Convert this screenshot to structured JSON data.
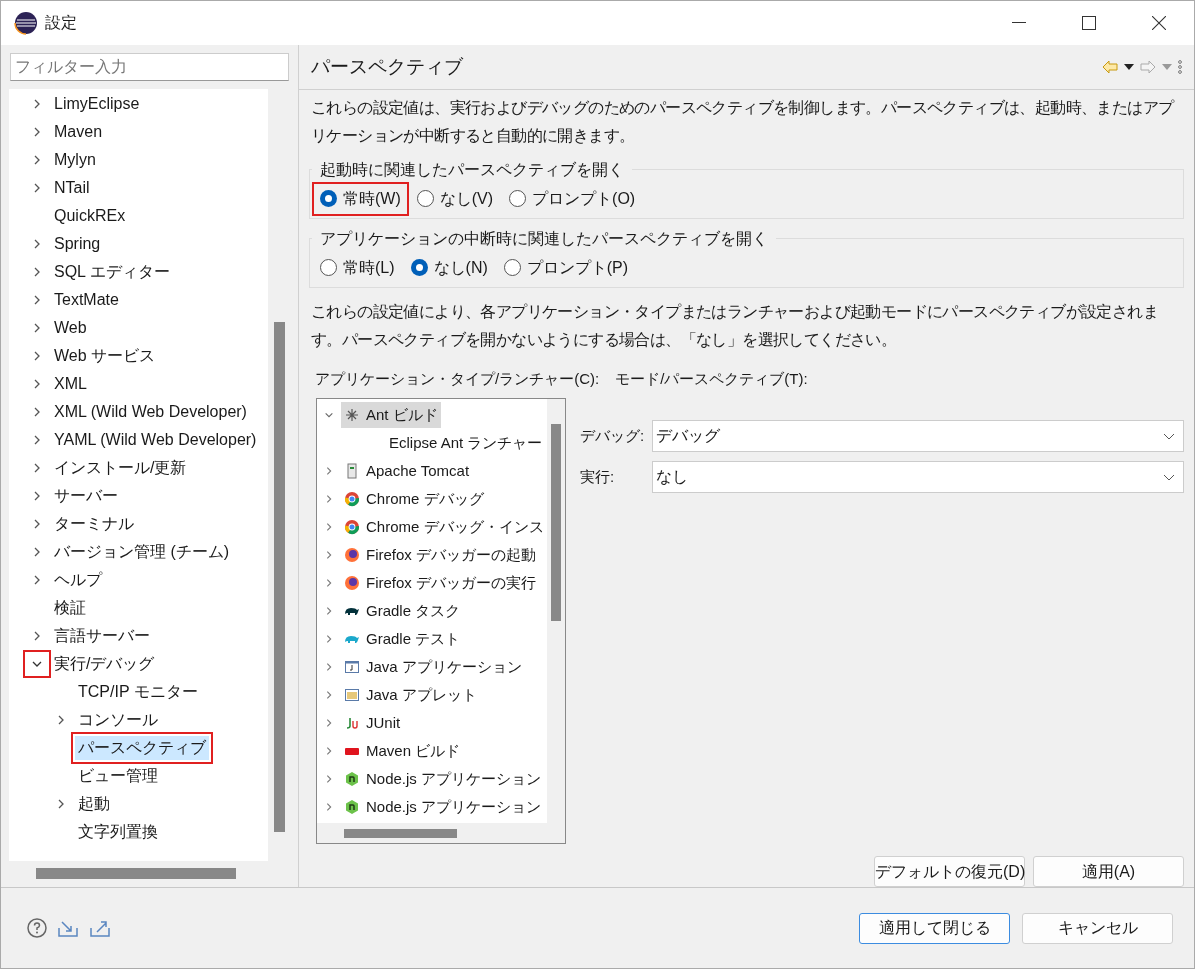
{
  "window": {
    "title": "設定"
  },
  "filter": {
    "placeholder": "フィルター入力"
  },
  "tree": {
    "items": [
      {
        "label": "LimyEclipse",
        "expanded": false,
        "selected": false
      },
      {
        "label": "Maven",
        "expanded": false,
        "selected": false
      },
      {
        "label": "Mylyn",
        "expanded": false,
        "selected": false
      },
      {
        "label": "NTail",
        "expanded": false,
        "selected": false
      },
      {
        "label": "QuickREx",
        "selected": false
      },
      {
        "label": "Spring",
        "expanded": false,
        "selected": false
      },
      {
        "label": "SQL エディター",
        "expanded": false,
        "selected": false
      },
      {
        "label": "TextMate",
        "expanded": false,
        "selected": false
      },
      {
        "label": "Web",
        "expanded": false,
        "selected": false
      },
      {
        "label": "Web サービス",
        "expanded": false,
        "selected": false
      },
      {
        "label": "XML",
        "expanded": false,
        "selected": false
      },
      {
        "label": "XML (Wild Web Developer)",
        "expanded": false,
        "selected": false
      },
      {
        "label": "YAML (Wild Web Developer)",
        "expanded": false,
        "selected": false
      },
      {
        "label": "インストール/更新",
        "expanded": false,
        "selected": false
      },
      {
        "label": "サーバー",
        "expanded": false,
        "selected": false
      },
      {
        "label": "ターミナル",
        "expanded": false,
        "selected": false
      },
      {
        "label": "バージョン管理 (チーム)",
        "expanded": false,
        "selected": false
      },
      {
        "label": "ヘルプ",
        "expanded": false,
        "selected": false
      },
      {
        "label": "検証",
        "selected": false
      },
      {
        "label": "言語サーバー",
        "expanded": false,
        "selected": false
      },
      {
        "label": "実行/デバッグ",
        "expanded": true,
        "selected": false,
        "caret_annotated": true,
        "children": [
          {
            "label": "TCP/IP モニター",
            "selected": false
          },
          {
            "label": "コンソール",
            "expanded": false,
            "selected": false
          },
          {
            "label": "パースペクティブ",
            "selected": true,
            "annotated": true
          },
          {
            "label": "ビュー管理",
            "selected": false
          },
          {
            "label": "起動",
            "expanded": false,
            "selected": false
          },
          {
            "label": "文字列置換",
            "selected": false
          }
        ]
      }
    ]
  },
  "page": {
    "title": "パースペクティブ",
    "description": "これらの設定値は、実行およびデバッグのためのパースペクティブを制御します。パースペクティブは、起動時、またはアプリケーションが中断すると自動的に開きます。",
    "groups": [
      {
        "legend": "起動時に関連したパースペクティブを開く",
        "options": [
          {
            "label": "常時(W)",
            "selected": true,
            "annotated": true
          },
          {
            "label": "なし(V)",
            "selected": false,
            "annotated": false
          },
          {
            "label": "プロンプト(O)",
            "selected": false,
            "annotated": false
          }
        ]
      },
      {
        "legend": "アプリケーションの中断時に関連したパースペクティブを開く",
        "options": [
          {
            "label": "常時(L)",
            "selected": false,
            "annotated": false
          },
          {
            "label": "なし(N)",
            "selected": true,
            "annotated": false
          },
          {
            "label": "プロンプト(P)",
            "selected": false,
            "annotated": false
          }
        ]
      }
    ],
    "description2": "これらの設定値により、各アプリケーション・タイプまたはランチャーおよび起動モードにパースペクティブが設定されます。パースペクティブを開かないようにする場合は、「なし」を選択してください。",
    "launchers_label": "アプリケーション・タイプ/ランチャー(C):",
    "modes_label": "モード/パースペクティブ(T):",
    "launchers": [
      {
        "label": "Ant ビルド",
        "kind": "ant",
        "expanded": true,
        "selected": true,
        "children": [
          {
            "label": "Eclipse Ant ランチャー",
            "selected": false
          }
        ]
      },
      {
        "label": "Apache Tomcat",
        "kind": "server",
        "expanded": false,
        "selected": false
      },
      {
        "label": "Chrome デバッグ",
        "kind": "chrome",
        "expanded": false,
        "selected": false
      },
      {
        "label": "Chrome デバッグ・インス",
        "kind": "chrome",
        "expanded": false,
        "selected": false
      },
      {
        "label": "Firefox デバッガーの起動",
        "kind": "firefox",
        "expanded": false,
        "selected": false
      },
      {
        "label": "Firefox デバッガーの実行",
        "kind": "firefox",
        "expanded": false,
        "selected": false
      },
      {
        "label": "Gradle タスク",
        "kind": "gradletask",
        "expanded": false,
        "selected": false
      },
      {
        "label": "Gradle テスト",
        "kind": "gradletest",
        "expanded": false,
        "selected": false
      },
      {
        "label": "Java アプリケーション",
        "kind": "javaapp",
        "expanded": false,
        "selected": false
      },
      {
        "label": "Java アプレット",
        "kind": "applet",
        "expanded": false,
        "selected": false
      },
      {
        "label": "JUnit",
        "kind": "junit",
        "expanded": false,
        "selected": false
      },
      {
        "label": "Maven ビルド",
        "kind": "maven",
        "expanded": false,
        "selected": false
      },
      {
        "label": "Node.js アプリケーション",
        "kind": "node",
        "expanded": false,
        "selected": false
      },
      {
        "label": "Node.js アプリケーション",
        "kind": "node",
        "expanded": false,
        "selected": false
      }
    ],
    "modes": [
      {
        "label": "デバッグ:",
        "value": "デバッグ"
      },
      {
        "label": "実行:",
        "value": "なし"
      }
    ],
    "buttons": [
      {
        "label": "デフォルトの復元(D)"
      },
      {
        "label": "適用(A)"
      }
    ]
  },
  "footer": {
    "buttons": [
      {
        "label": "適用して閉じる",
        "default": true
      },
      {
        "label": "キャンセル",
        "default": false
      }
    ]
  }
}
